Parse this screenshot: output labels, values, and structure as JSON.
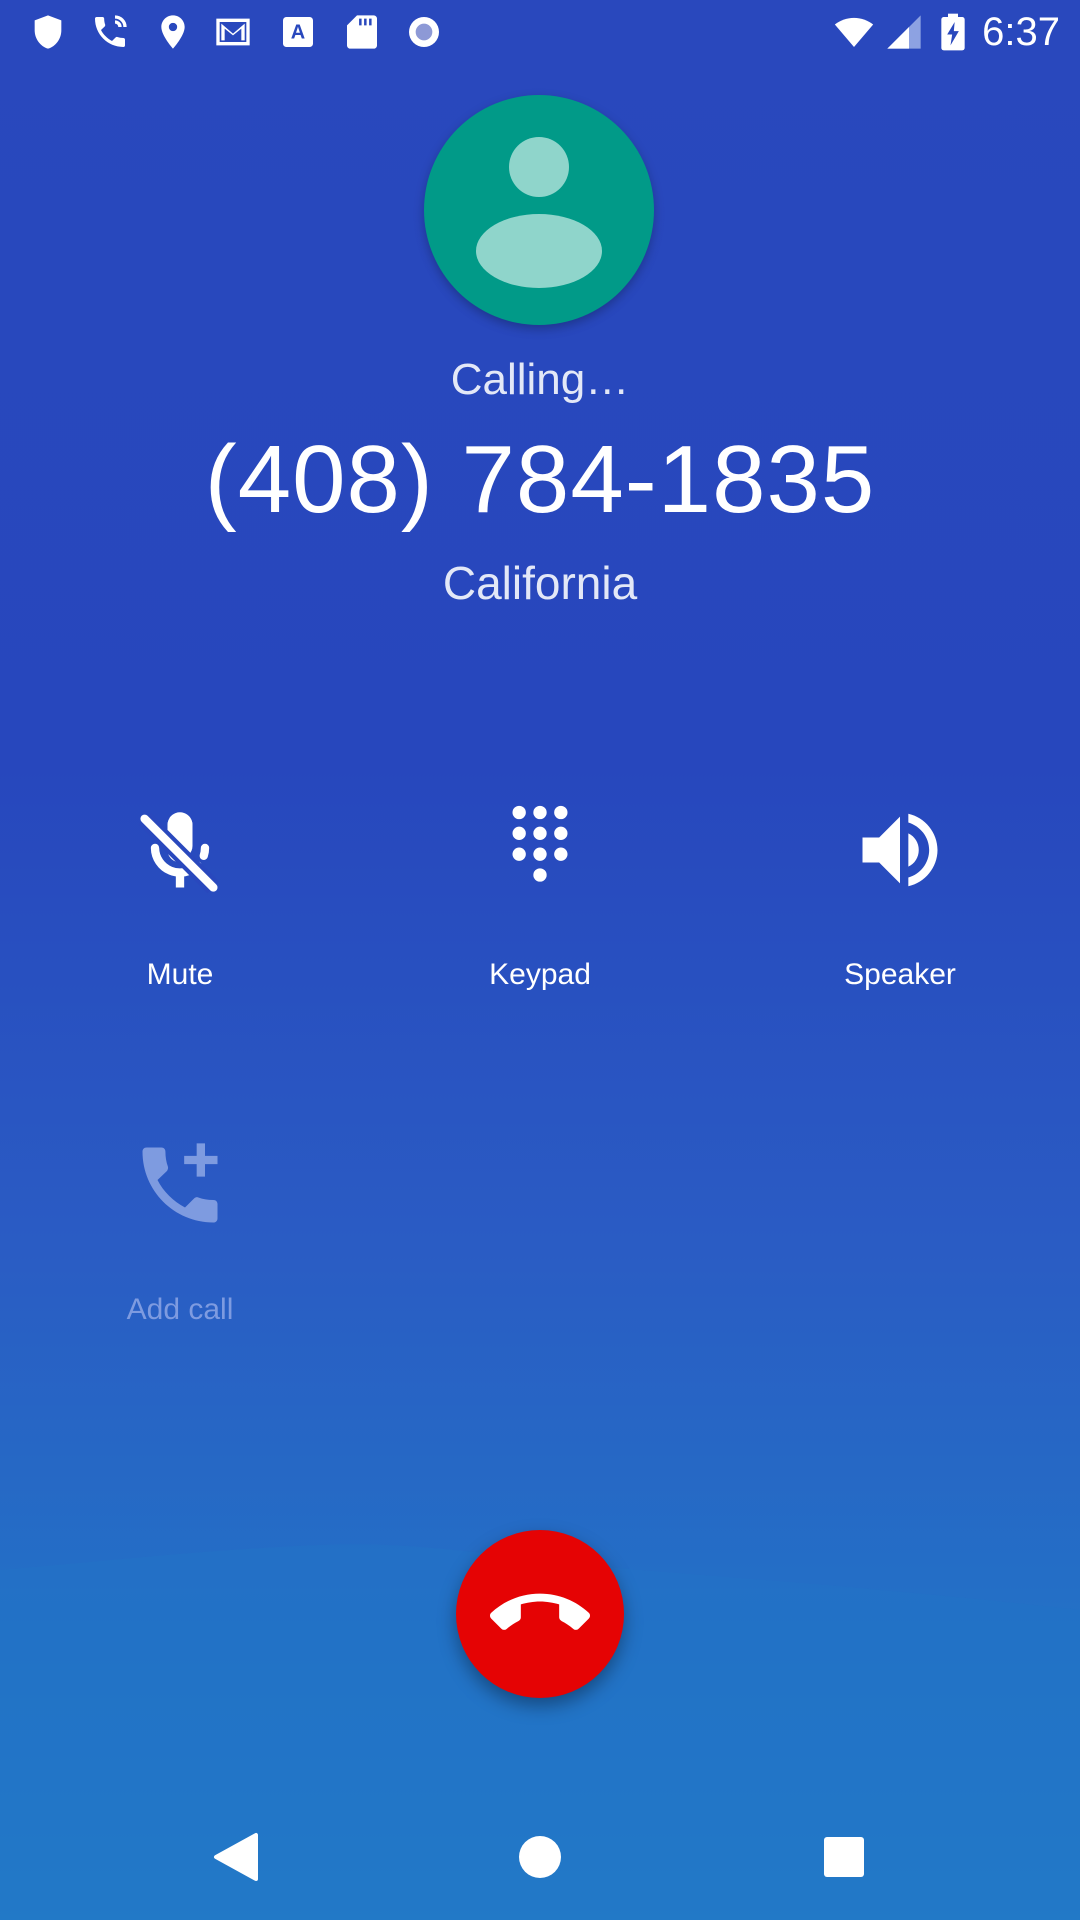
{
  "status_bar": {
    "time": "6:37",
    "left_icons": [
      "shield-icon",
      "phone-call-icon",
      "location-pin-icon",
      "gmail-icon",
      "text-a-icon",
      "sd-card-icon",
      "record-dot-icon"
    ],
    "right_icons": [
      "wifi-icon",
      "cell-signal-icon",
      "battery-charging-icon"
    ]
  },
  "call": {
    "status": "Calling…",
    "number": "(408) 784-1835",
    "location": "California",
    "avatar_icon": "person-icon"
  },
  "controls": [
    {
      "label": "Mute",
      "icon": "mic-off-icon",
      "enabled": true
    },
    {
      "label": "Keypad",
      "icon": "dialpad-icon",
      "enabled": true
    },
    {
      "label": "Speaker",
      "icon": "volume-up-icon",
      "enabled": true
    },
    {
      "label": "Add call",
      "icon": "add-call-icon",
      "enabled": false
    }
  ],
  "end_call": {
    "icon": "call-end-icon",
    "color": "#e50304"
  },
  "nav_bar": {
    "items": [
      "back-icon",
      "home-icon",
      "recents-icon"
    ]
  },
  "colors": {
    "background": "#2948bd",
    "avatar": "#019a88",
    "avatar_fg": "#8fd5cb",
    "disabled": "#7e9be0"
  }
}
